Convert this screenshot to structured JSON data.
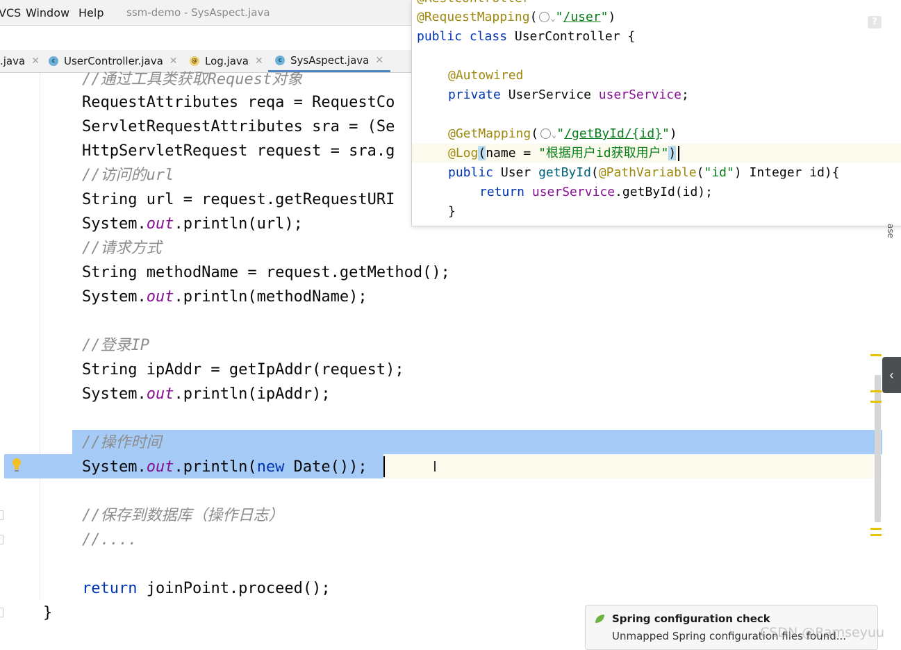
{
  "menubar": {
    "items": [
      "VCS",
      "Window",
      "Help"
    ],
    "window_title": "ssm-demo - SysAspect.java"
  },
  "tabs": [
    {
      "label": ".java",
      "icon": "java-file-icon",
      "active": false
    },
    {
      "label": "UserController.java",
      "icon": "class-icon",
      "active": false
    },
    {
      "label": "Log.java",
      "icon": "annotation-icon",
      "active": false
    },
    {
      "label": "SysAspect.java",
      "icon": "class-icon",
      "active": true
    }
  ],
  "editor": {
    "lines": [
      {
        "comment": "//通过工具类获取Request对象"
      },
      {
        "text": "RequestAttributes reqa = RequestCo"
      },
      {
        "text": "ServletRequestAttributes sra = (Se"
      },
      {
        "text": "HttpServletRequest request = sra.g"
      },
      {
        "comment": "//访问的url"
      },
      {
        "text": "String url = request.getRequestURI"
      },
      {
        "prefix": "System.",
        "field": "out",
        "suffix": ".println(url);"
      },
      {
        "comment": "//请求方式"
      },
      {
        "text": "String methodName = request.getMethod();"
      },
      {
        "prefix": "System.",
        "field": "out",
        "suffix": ".println(methodName);"
      },
      {
        "comment": "//登录IP"
      },
      {
        "text": "String ipAddr = getIpAddr(request);"
      },
      {
        "prefix": "System.",
        "field": "out",
        "suffix": ".println(ipAddr);"
      },
      {
        "comment": "//操作时间"
      },
      {
        "prefix": "System.",
        "field": "out",
        "mid": ".println(",
        "keyword": "new",
        "suffix": " Date());"
      },
      {
        "comment": "//保存到数据库（操作日志）"
      },
      {
        "comment": "//...."
      },
      {
        "keyword": "return",
        "suffix": " joinPoint.proceed();"
      },
      {
        "text": "}"
      }
    ]
  },
  "popup": {
    "partial_line": "@RestController",
    "request_mapping": {
      "annotation": "@RequestMapping",
      "path": "/user"
    },
    "class_decl": {
      "kw": "public class",
      "name": " UserController {"
    },
    "autowired": "@Autowired",
    "field_decl": {
      "kw": "private",
      "type": " UserService ",
      "name": "userService",
      "end": ";"
    },
    "get_mapping": {
      "annotation": "@GetMapping",
      "path": "/getById/{id}"
    },
    "log": {
      "annotation": "@Log",
      "param": "name = ",
      "value": "\"根据用户id获取用户\""
    },
    "method_decl": {
      "kw": "public",
      "type": " User ",
      "name": "getById",
      "ann": "@PathVariable",
      "arg": "\"id\"",
      "rest": " Integer id){"
    },
    "return_line": {
      "kw": "return",
      "obj": "userService",
      "call": ".getById(id);"
    },
    "close": "}"
  },
  "sidebar": {
    "vertical_label": "ase"
  },
  "notification": {
    "title": "Spring configuration check",
    "body": "Unmapped Spring configuration files found..."
  },
  "watermark": "CSDN @Ramseyuu",
  "colors": {
    "keyword": "#0033b3",
    "comment": "#8c8c8c",
    "field": "#871094",
    "annotation": "#9e880d",
    "string": "#067d17",
    "selection": "#a6cbf7"
  }
}
